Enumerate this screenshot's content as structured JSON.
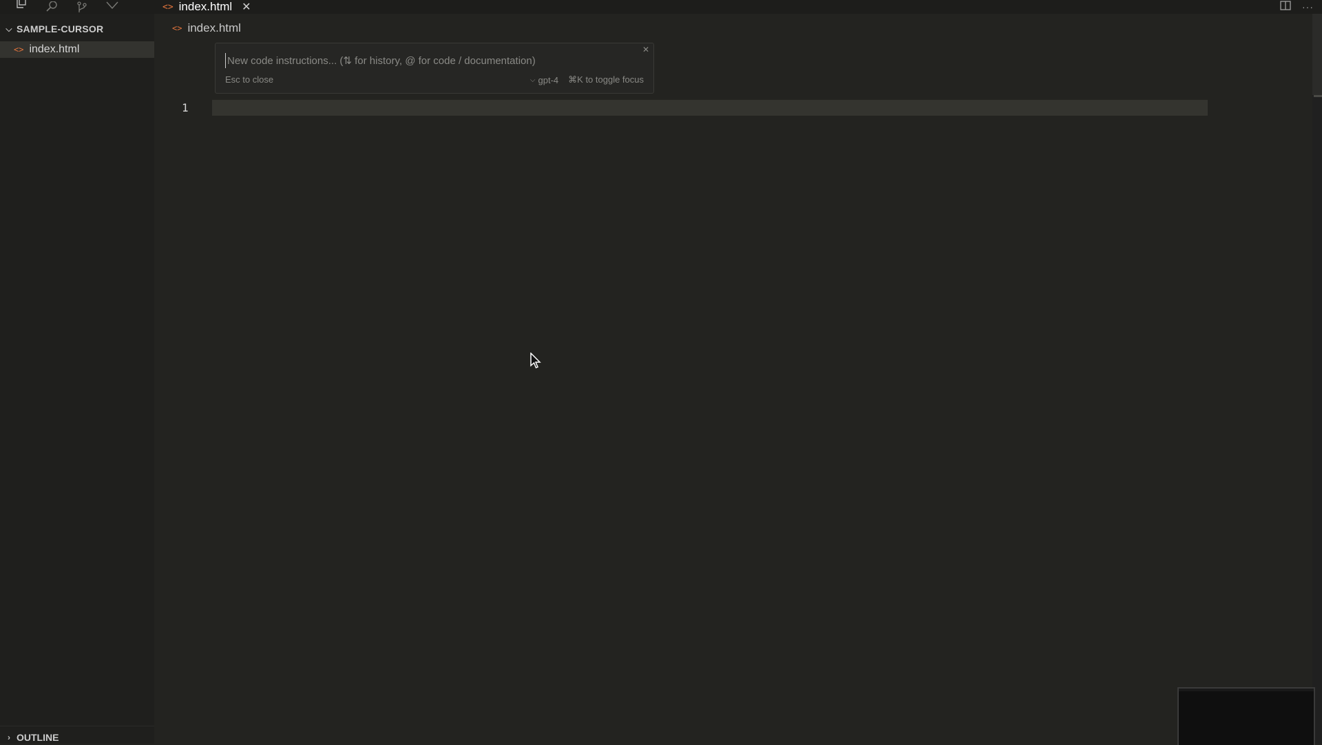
{
  "app": {
    "activity_icons": [
      "files-icon",
      "search-icon",
      "source-control-icon",
      "extensions-icon"
    ]
  },
  "tabs": [
    {
      "label": "index.html",
      "icon": "html-icon",
      "active": true
    }
  ],
  "explorer": {
    "title": "SAMPLE-CURSOR",
    "files": [
      {
        "name": "index.html",
        "icon": "html-icon",
        "selected": true
      }
    ],
    "outline_label": "OUTLINE"
  },
  "editor": {
    "breadcrumb": "index.html",
    "line_numbers": [
      "1"
    ],
    "prompt": {
      "placeholder": "New code instructions... (⇅ for history, @ for code / documentation)",
      "esc_hint": "Esc to close",
      "model": "gpt-4",
      "toggle_hint": "⌘K to toggle focus"
    }
  },
  "colors": {
    "background": "#232320",
    "sidebar": "#1f1f1d",
    "html_icon": "#e0733c",
    "current_line": "#34342f"
  }
}
